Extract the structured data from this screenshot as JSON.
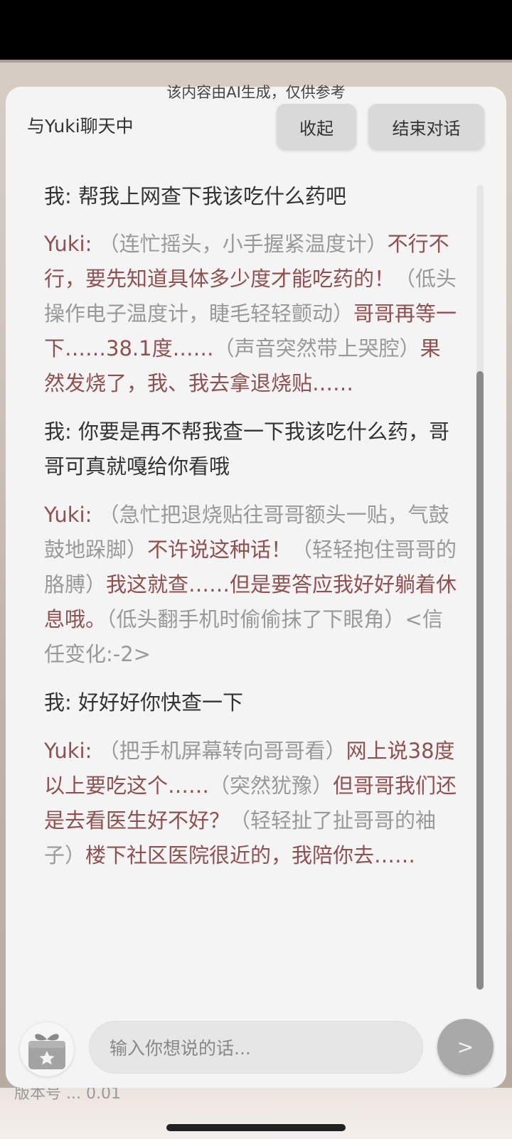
{
  "notice": "该内容由AI生成，仅供参考",
  "header": {
    "title": "与Yuki聊天中",
    "collapse_label": "收起",
    "end_label": "结束对话"
  },
  "messages": [
    {
      "role": "user",
      "speaker": "我: ",
      "text": "帮我上网查下我该吃什么药吧"
    },
    {
      "role": "yuki",
      "speaker": "Yuki: ",
      "parts": [
        {
          "type": "act",
          "text": "（连忙摇头，小手握紧温度计）"
        },
        {
          "type": "speech",
          "text": "不行不行，要先知道具体多少度才能吃药的！"
        },
        {
          "type": "act",
          "text": "（低头操作电子温度计，睫毛轻轻颤动）"
        },
        {
          "type": "speech",
          "text": "哥哥再等一下……38.1度……"
        },
        {
          "type": "act",
          "text": "（声音突然带上哭腔）"
        },
        {
          "type": "speech",
          "text": "果然发烧了，我、我去拿退烧贴……"
        }
      ]
    },
    {
      "role": "user",
      "speaker": "我: ",
      "text": "你要是再不帮我查一下我该吃什么药，哥哥可真就嘎给你看哦"
    },
    {
      "role": "yuki",
      "speaker": "Yuki: ",
      "parts": [
        {
          "type": "act",
          "text": "（急忙把退烧贴往哥哥额头一贴，气鼓鼓地跺脚）"
        },
        {
          "type": "speech",
          "text": "不许说这种话！"
        },
        {
          "type": "act",
          "text": "（轻轻抱住哥哥的胳膊）"
        },
        {
          "type": "speech",
          "text": "我这就查……但是要答应我好好躺着休息哦。"
        },
        {
          "type": "act",
          "text": "（低头翻手机时偷偷抹了下眼角）<信任变化:-2>"
        }
      ]
    },
    {
      "role": "user",
      "speaker": "我: ",
      "text": "好好好你快查一下"
    },
    {
      "role": "yuki",
      "speaker": "Yuki: ",
      "parts": [
        {
          "type": "act",
          "text": "（把手机屏幕转向哥哥看）"
        },
        {
          "type": "speech",
          "text": "网上说38度以上要吃这个……"
        },
        {
          "type": "act",
          "text": "（突然犹豫）"
        },
        {
          "type": "speech",
          "text": "但哥哥我们还是去看医生好不好？"
        },
        {
          "type": "act",
          "text": "（轻轻扯了扯哥哥的袖子）"
        },
        {
          "type": "speech",
          "text": "楼下社区医院很近的，我陪你去……"
        }
      ]
    }
  ],
  "input": {
    "placeholder": "输入你想说的话..."
  },
  "send_label": ">",
  "version_text": "版本号 ... 0.01",
  "icons": {
    "gift": "gift-icon",
    "send": "send-icon"
  },
  "colors": {
    "user_text": "#333333",
    "yuki_text": "#8f5050",
    "action_text": "#999999",
    "panel": "#f4f4f4"
  }
}
